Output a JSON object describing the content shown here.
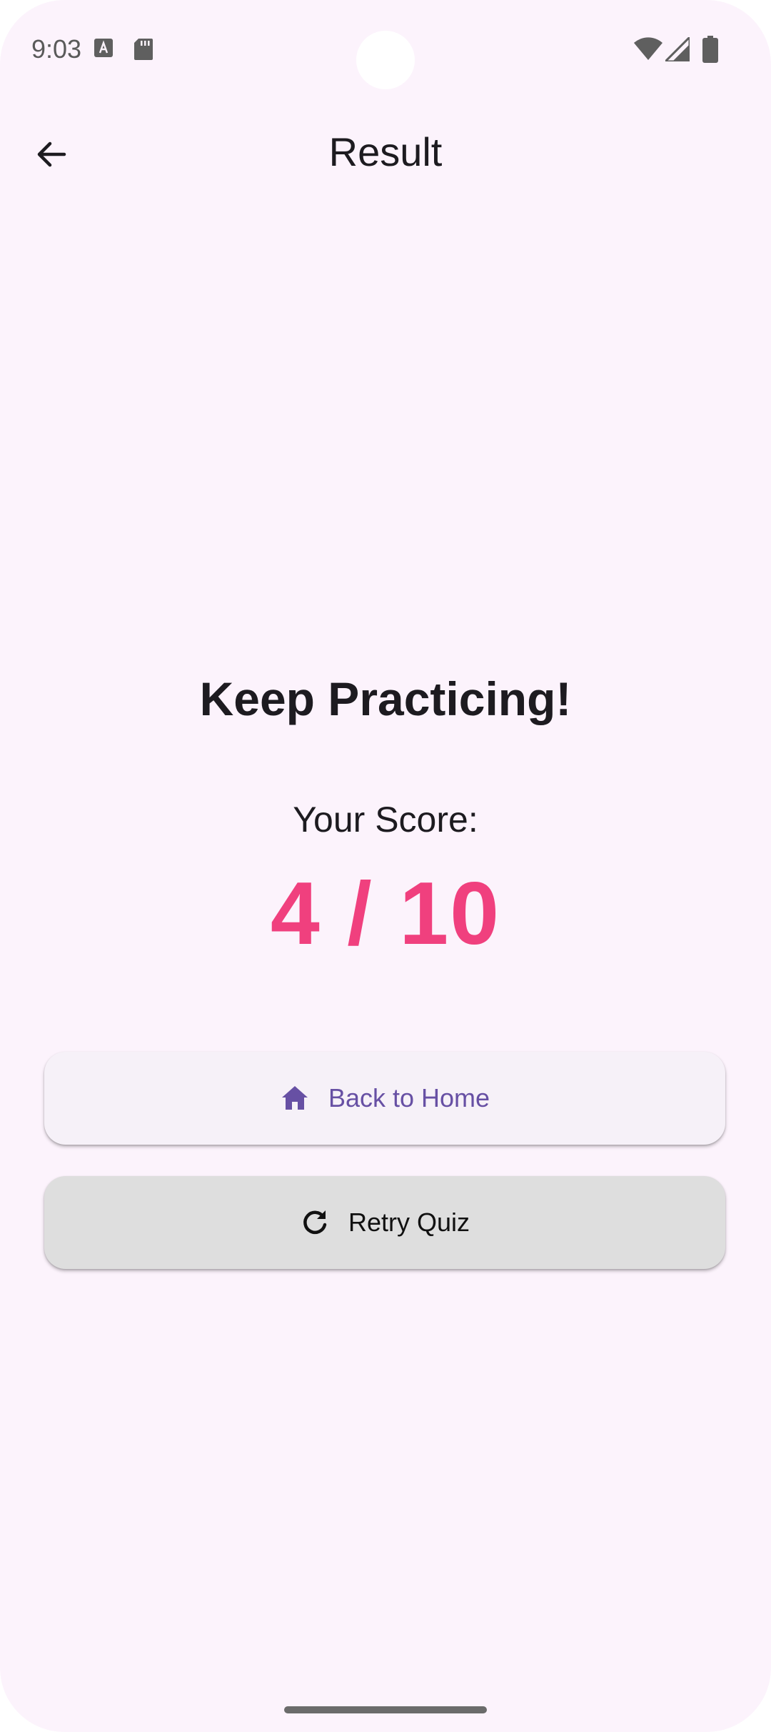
{
  "status_bar": {
    "time": "9:03",
    "icons": [
      "text-notification-icon",
      "sd-card-icon",
      "wifi-icon",
      "cell-signal-icon",
      "battery-icon"
    ]
  },
  "app_bar": {
    "title": "Result",
    "back_icon": "arrow-back-icon"
  },
  "result": {
    "headline": "Keep Practicing!",
    "score_label": "Your Score:",
    "score_text": "4 / 10",
    "score_correct": 4,
    "score_total": 10
  },
  "buttons": {
    "home_label": "Back to Home",
    "home_icon": "home-icon",
    "retry_label": "Retry Quiz",
    "retry_icon": "refresh-icon"
  },
  "colors": {
    "background": "#fcf3fc",
    "score_accent": "#f0407e",
    "primary": "#6750a4",
    "retry_button": "#dedede"
  }
}
